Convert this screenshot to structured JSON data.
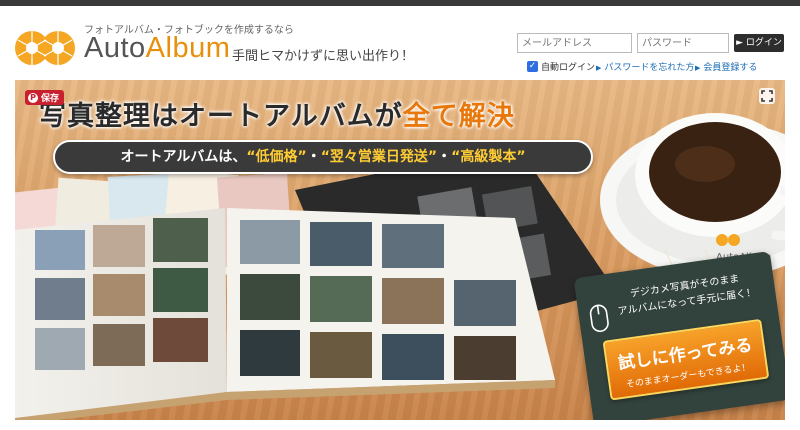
{
  "brand": {
    "tagline": "フォトアルバム・フォトブックを作成するなら",
    "name_part1": "Auto",
    "name_part2": "Album",
    "slogan": "手間ヒマかけずに思い出作り！",
    "accent_color": "#e8900c"
  },
  "login": {
    "email_placeholder": "メールアドレス",
    "password_placeholder": "パスワード",
    "login_button": "► ログイン",
    "auto_login_label": "自動ログイン",
    "auto_login_checked": true,
    "forgot_password_link": "パスワードを忘れた方",
    "register_link": "会員登録する"
  },
  "hero": {
    "save_badge": "保存",
    "headline_main": "写真整理はオートアルバムが",
    "headline_accent": "全て解決",
    "pill_prefix": "オートアルバムは、",
    "pill_highlight1": "“低価格”",
    "pill_sep1": "・",
    "pill_highlight2": "“翌々営業日発送”",
    "pill_sep2": "・",
    "pill_highlight3": "“高級製本”",
    "cup_logo": "AutoAlbum",
    "board_line1": "デジカメ写真がそのまま",
    "board_line2": "アルバムになって手元に届く！",
    "cta_main": "試しに作ってみる",
    "cta_sub": "そのままオーダーもできるよ！"
  },
  "icons": {
    "logo": "autoalbum-logo-icon",
    "save": "pinterest-save-icon",
    "expand": "expand-icon",
    "mouse": "mouse-icon"
  }
}
